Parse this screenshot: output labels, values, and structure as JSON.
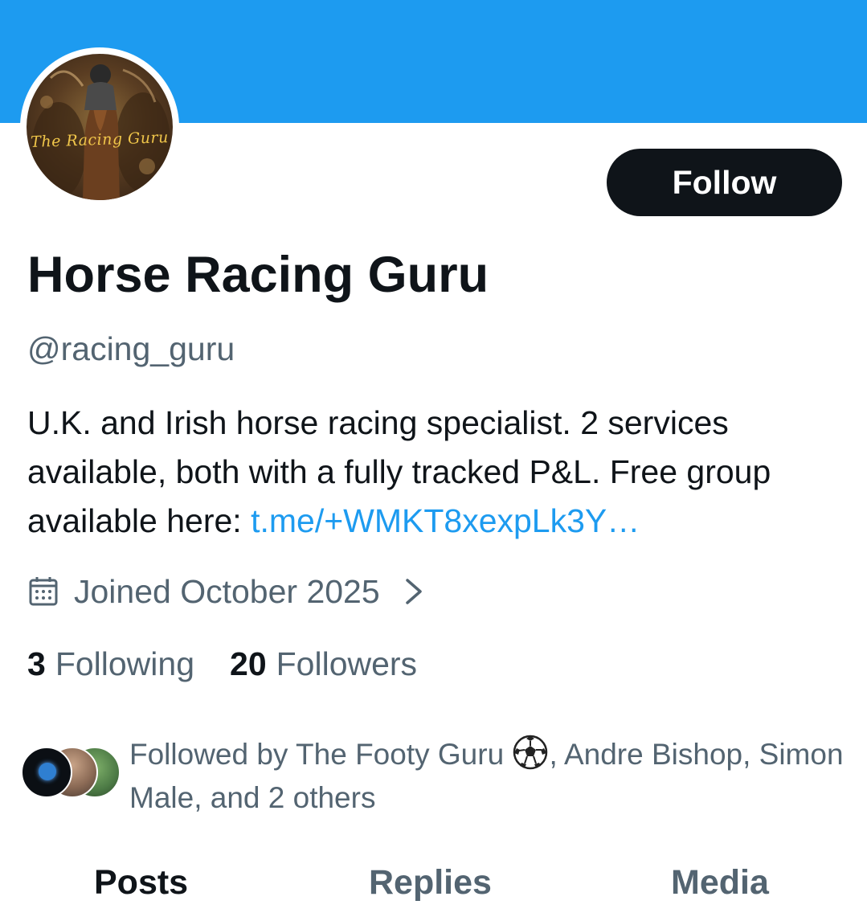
{
  "profile": {
    "display_name": "Horse Racing Guru",
    "handle": "@racing_guru",
    "avatar_logo_text": "The Racing Guru",
    "follow_label": "Follow",
    "bio_text": "U.K. and Irish horse racing specialist. 2 services available, both with a fully tracked P&L. Free group available here: ",
    "bio_link": "t.me/+WMKT8xexpLk3Y…",
    "joined_text": "Joined October 2025",
    "following_count": "3",
    "following_label": "Following",
    "followers_count": "20",
    "followers_label": "Followers"
  },
  "followed_by": {
    "text_before_icon": "Followed by The Footy Guru ",
    "icon": "soccer-ball-icon",
    "text_after_icon": ", Andre Bishop, Simon Male, and 2 others"
  },
  "tabs": [
    "Posts",
    "Replies",
    "Media"
  ],
  "colors": {
    "banner": "#1d9bf0",
    "link": "#1d9bf0",
    "primary_text": "#0f1419",
    "secondary_text": "#536471",
    "follow_button_bg": "#0f1419"
  }
}
